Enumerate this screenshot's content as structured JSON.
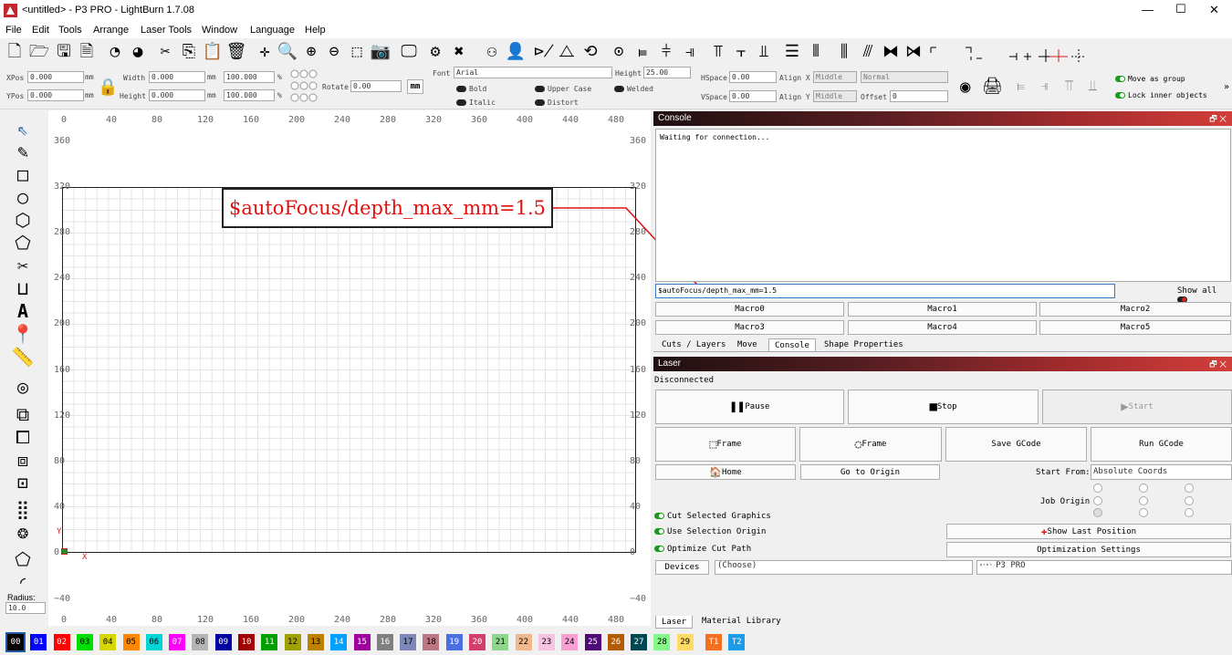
{
  "window": {
    "title": "<untitled> - P3 PRO - LightBurn 1.7.08",
    "minimize": "—",
    "maximize": "☐",
    "close": "✕"
  },
  "menu": [
    "File",
    "Edit",
    "Tools",
    "Arrange",
    "Laser Tools",
    "Window",
    "Language",
    "Help"
  ],
  "toolbar_icons": [
    "new-file-icon",
    "open-folder-icon",
    "save-icon",
    "save-as-icon",
    "undo-icon",
    "redo-icon",
    "cut-icon",
    "copy-icon",
    "paste-icon",
    "delete-icon",
    "move-icon",
    "zoom-in-icon",
    "zoom-plus-icon",
    "zoom-minus-icon",
    "zoom-frame-icon",
    "camera-icon",
    "monitor-icon",
    "settings-icon",
    "tools-icon",
    "group-icon",
    "user-icon",
    "mirror-horizontal-icon",
    "mirror-vertical-icon",
    "rotate-icon",
    "target-icon",
    "align-left-icon",
    "align-center-icon",
    "align-right-icon",
    "align-top-icon",
    "align-middle-icon",
    "align-bottom-icon",
    "distribute-icon"
  ],
  "props": {
    "xpos_label": "XPos",
    "xpos": "0.000",
    "ypos_label": "YPos",
    "ypos": "0.000",
    "mm": "mm",
    "width_label": "Width",
    "width": "0.000",
    "height_label": "Height",
    "height": "0.000",
    "pct_w": "100.000",
    "pct_h": "100.000",
    "pct": "%",
    "rotate_label": "Rotate",
    "rotate": "0.00",
    "mm_btn": "mm",
    "font_label": "Font",
    "font": "Arial",
    "fheight_label": "Height",
    "fheight": "25.00",
    "bold": "Bold",
    "italic": "Italic",
    "upper": "Upper Case",
    "distort": "Distort",
    "welded": "Welded",
    "hspace_label": "HSpace",
    "hspace": "0.00",
    "vspace_label": "VSpace",
    "vspace": "0.00",
    "alignx_label": "Align X",
    "alignx": "Middle",
    "aligny_label": "Align Y",
    "aligny": "Middle",
    "normal": "Normal",
    "offset_label": "Offset",
    "offset": "0",
    "move_group": "Move as group",
    "lock_inner": "Lock inner objects",
    "more": "»"
  },
  "left_tools": [
    "select-icon",
    "pencil-icon",
    "rectangle-icon",
    "ellipse-icon",
    "polygon-icon",
    "pentagon-icon",
    "trim-icon",
    "measure-frame-icon",
    "text-icon",
    "position-marker-icon",
    "ruler-icon",
    "offset-icon",
    "boolean-union-icon",
    "boolean-subtract-icon",
    "boolean-intersect-icon",
    "weld-icon",
    "grid-array-icon",
    "circular-array-icon",
    "corner-icon",
    "radius-icon"
  ],
  "radius": {
    "label": "Radius:",
    "value": "10.0"
  },
  "ruler": {
    "top": [
      "0",
      "40",
      "80",
      "120",
      "160",
      "200",
      "240",
      "280",
      "320",
      "360",
      "400",
      "440",
      "480"
    ],
    "bottom": [
      "0",
      "40",
      "80",
      "120",
      "160",
      "200",
      "240",
      "280",
      "320",
      "360",
      "400",
      "440",
      "480"
    ],
    "left": [
      "360",
      "320",
      "280",
      "240",
      "200",
      "160",
      "120",
      "80",
      "40",
      "0",
      "−40"
    ],
    "right": [
      "360",
      "320",
      "280",
      "240",
      "200",
      "160",
      "120",
      "80",
      "40",
      "0",
      "−40"
    ],
    "y_axis": "Y",
    "x_axis": "X"
  },
  "callout_text": "$autoFocus/depth_max_mm=1.5",
  "console": {
    "title": "Console",
    "float_icon": "🗗",
    "close_icon": "✕",
    "output": "Waiting for connection...",
    "input": "$autoFocus/depth_max_mm=1.5",
    "show_all": "Show all",
    "macros": [
      "Macro0",
      "Macro1",
      "Macro2",
      "Macro3",
      "Macro4",
      "Macro5"
    ]
  },
  "tabs": [
    "Cuts / Layers",
    "Move",
    "Console",
    "Shape Properties"
  ],
  "laser": {
    "title": "Laser",
    "status": "Disconnected",
    "pause": "Pause",
    "stop": "Stop",
    "start": "Start",
    "frame1": "Frame",
    "frame2": "Frame",
    "save_gcode": "Save GCode",
    "run_gcode": "Run GCode",
    "home": "Home",
    "go_origin": "Go to Origin",
    "start_from_label": "Start From:",
    "start_from": "Absolute Coords",
    "job_origin": "Job Origin",
    "cut_selected": "Cut Selected Graphics",
    "use_selection": "Use Selection Origin",
    "optimize": "Optimize Cut Path",
    "show_last": "Show Last Position",
    "opt_settings": "Optimization Settings",
    "devices": "Devices",
    "choose": "(Choose)",
    "device": "P3 PRO"
  },
  "bottom_tabs": [
    "Laser",
    "Material Library"
  ],
  "palette": [
    {
      "l": "00",
      "c": "#000000",
      "t": "#ffffff"
    },
    {
      "l": "01",
      "c": "#0000ff",
      "t": "#ffffff"
    },
    {
      "l": "02",
      "c": "#ff0000",
      "t": "#ffffff"
    },
    {
      "l": "03",
      "c": "#00e000",
      "t": "#000000"
    },
    {
      "l": "04",
      "c": "#d6d600",
      "t": "#000000"
    },
    {
      "l": "05",
      "c": "#ff8800",
      "t": "#000000"
    },
    {
      "l": "06",
      "c": "#00d6d6",
      "t": "#000000"
    },
    {
      "l": "07",
      "c": "#ff00ff",
      "t": "#ffffff"
    },
    {
      "l": "08",
      "c": "#b4b4b4",
      "t": "#000000"
    },
    {
      "l": "09",
      "c": "#0000a0",
      "t": "#ffffff"
    },
    {
      "l": "10",
      "c": "#a00000",
      "t": "#ffffff"
    },
    {
      "l": "11",
      "c": "#00a000",
      "t": "#ffffff"
    },
    {
      "l": "12",
      "c": "#a0a000",
      "t": "#000000"
    },
    {
      "l": "13",
      "c": "#c08000",
      "t": "#000000"
    },
    {
      "l": "14",
      "c": "#00a0ff",
      "t": "#ffffff"
    },
    {
      "l": "15",
      "c": "#a000a0",
      "t": "#ffffff"
    },
    {
      "l": "16",
      "c": "#808080",
      "t": "#ffffff"
    },
    {
      "l": "17",
      "c": "#7d87b9",
      "t": "#000000"
    },
    {
      "l": "18",
      "c": "#bb7784",
      "t": "#000000"
    },
    {
      "l": "19",
      "c": "#4a6fe3",
      "t": "#ffffff"
    },
    {
      "l": "20",
      "c": "#d33f6a",
      "t": "#ffffff"
    },
    {
      "l": "21",
      "c": "#8cd78c",
      "t": "#000000"
    },
    {
      "l": "22",
      "c": "#f0b98d",
      "t": "#000000"
    },
    {
      "l": "23",
      "c": "#f6c4e1",
      "t": "#000000"
    },
    {
      "l": "24",
      "c": "#fa9ed4",
      "t": "#000000"
    },
    {
      "l": "25",
      "c": "#500a78",
      "t": "#ffffff"
    },
    {
      "l": "26",
      "c": "#b45a00",
      "t": "#ffffff"
    },
    {
      "l": "27",
      "c": "#004754",
      "t": "#ffffff"
    },
    {
      "l": "28",
      "c": "#86fa88",
      "t": "#000000"
    },
    {
      "l": "29",
      "c": "#ffdb66",
      "t": "#000000"
    },
    {
      "l": "T1",
      "c": "#f37021",
      "t": "#ffffff"
    },
    {
      "l": "T2",
      "c": "#1e9be6",
      "t": "#ffffff"
    }
  ]
}
